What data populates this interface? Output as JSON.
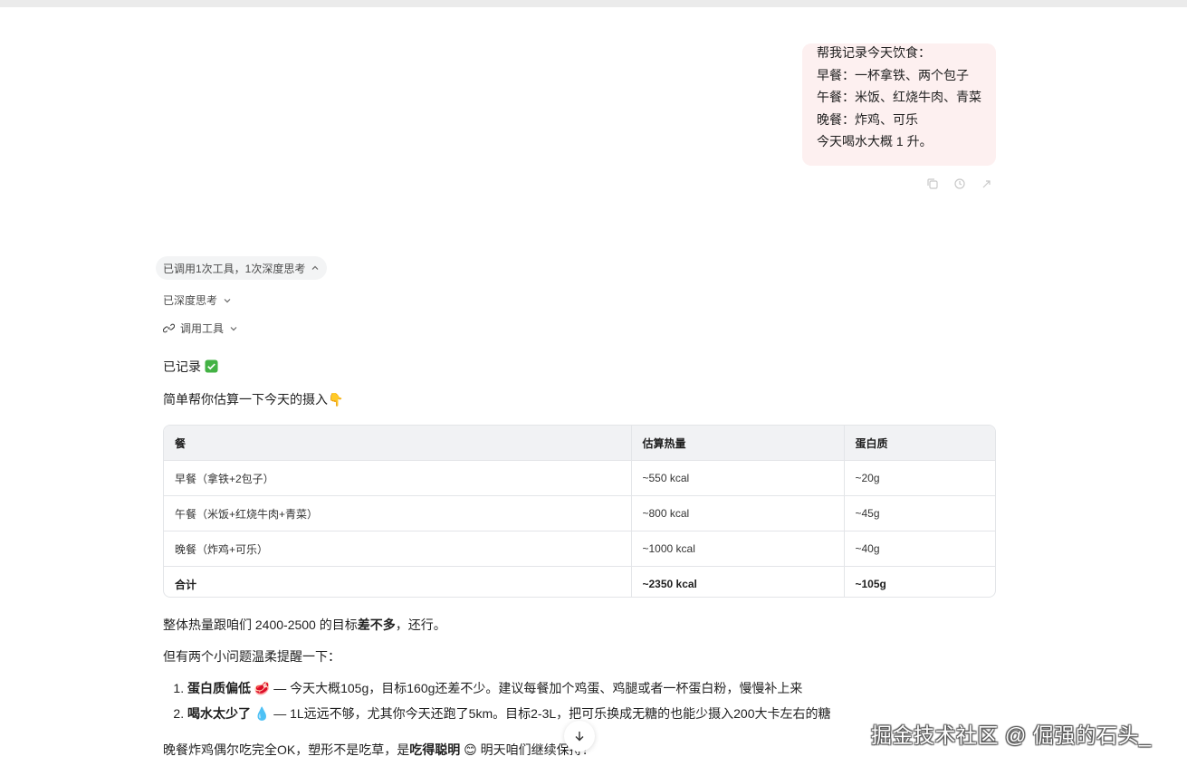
{
  "user_message": {
    "lines": [
      "帮我记录今天饮食：",
      "早餐：一杯拿铁、两个包子",
      "午餐：米饭、红烧牛肉、青菜",
      "晚餐：炸鸡、可乐",
      "今天喝水大概 1 升。"
    ],
    "actions": [
      "copy-icon",
      "edit-icon",
      "share-icon"
    ]
  },
  "assistant": {
    "tool_summary": "已调用1次工具，1次深度思考",
    "deep_thinking": "已深度思考",
    "tool_call": "调用工具",
    "recorded": "已记录",
    "recorded_emoji": "✅",
    "intro": "简单帮你估算一下今天的摄入",
    "intro_emoji": "👇",
    "table": {
      "headers": [
        "餐",
        "估算热量",
        "蛋白质"
      ],
      "rows": [
        [
          "早餐（拿铁+2包子）",
          "~550 kcal",
          "~20g"
        ],
        [
          "午餐（米饭+红烧牛肉+青菜）",
          "~800 kcal",
          "~45g"
        ],
        [
          "晚餐（炸鸡+可乐）",
          "~1000 kcal",
          "~40g"
        ],
        [
          "合计",
          "~2350 kcal",
          "~105g"
        ]
      ]
    },
    "summary": {
      "pre": "整体热量跟咱们 2400-2500 的目标",
      "bold": "差不多",
      "post": "，还行。"
    },
    "reminder_intro": "但有两个小问题温柔提醒一下：",
    "tips": [
      {
        "bold": "蛋白质偏低",
        "emoji": "🥩",
        "text": " — 今天大概105g，目标160g还差不少。建议每餐加个鸡蛋、鸡腿或者一杯蛋白粉，慢慢补上来"
      },
      {
        "bold": "喝水太少了",
        "emoji": "💧",
        "text": " — 1L远远不够，尤其你今天还跑了5km。目标2-3L，把可乐换成无糖的也能少摄入200大卡左右的糖"
      }
    ],
    "closing": {
      "pre": "晚餐炸鸡偶尔吃完全OK，塑形不是吃草，是",
      "bold": "吃得聪明",
      "emoji": "😊",
      "post": " 明天咱们继续保持！"
    }
  },
  "watermark": "掘金技术社区 @ 倔强的石头_",
  "colors": {
    "user_bubble": "#fdf0f0",
    "table_header": "#f1f2f4",
    "chip": "#f3f4f5"
  }
}
